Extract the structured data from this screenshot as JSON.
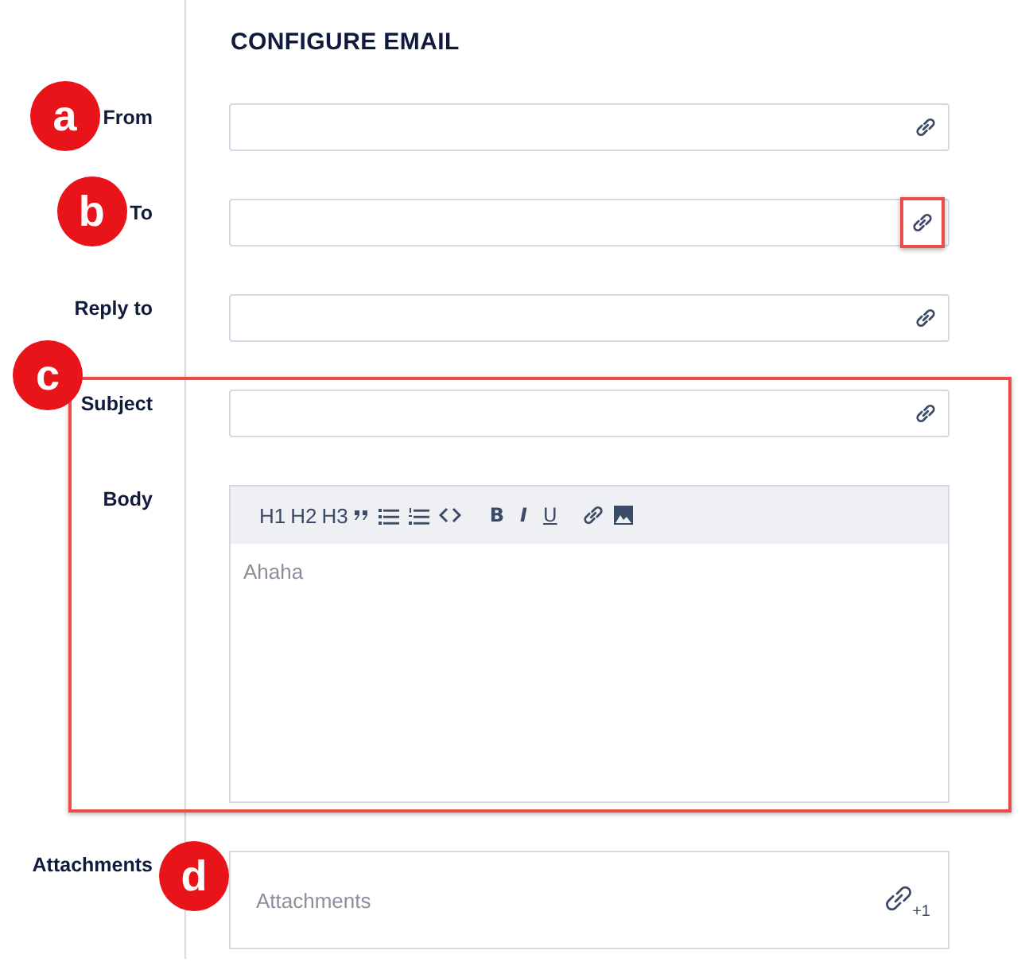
{
  "heading": "CONFIGURE EMAIL",
  "fields": [
    {
      "kind": "text",
      "label": "From",
      "callout": "a",
      "link_highlighted": false,
      "in_highlight": false
    },
    {
      "kind": "text",
      "label": "To",
      "callout": "b",
      "link_highlighted": true,
      "in_highlight": false
    },
    {
      "kind": "text",
      "label": "Reply to",
      "link_highlighted": false,
      "in_highlight": false
    },
    {
      "kind": "text",
      "label": "Subject",
      "link_highlighted": false,
      "in_highlight": true
    },
    {
      "kind": "editor",
      "label": "Body",
      "placeholder": "Ahaha",
      "in_highlight": true,
      "toolbar": [
        {
          "kind": "heading",
          "label": "H1"
        },
        {
          "kind": "heading",
          "label": "H2"
        },
        {
          "kind": "heading",
          "label": "H3"
        },
        {
          "kind": "quote"
        },
        {
          "kind": "bullets"
        },
        {
          "kind": "numbers"
        },
        {
          "kind": "code"
        },
        {
          "kind": "bold",
          "label": "B"
        },
        {
          "kind": "italic",
          "label": "I"
        },
        {
          "kind": "underline",
          "label": "U"
        },
        {
          "kind": "link"
        },
        {
          "kind": "image"
        }
      ]
    },
    {
      "kind": "attachments",
      "label": "Attachments",
      "placeholder": "Attachments",
      "count": "+1",
      "callout": "d",
      "in_highlight": false
    }
  ],
  "highlight": {
    "callout": "c"
  }
}
